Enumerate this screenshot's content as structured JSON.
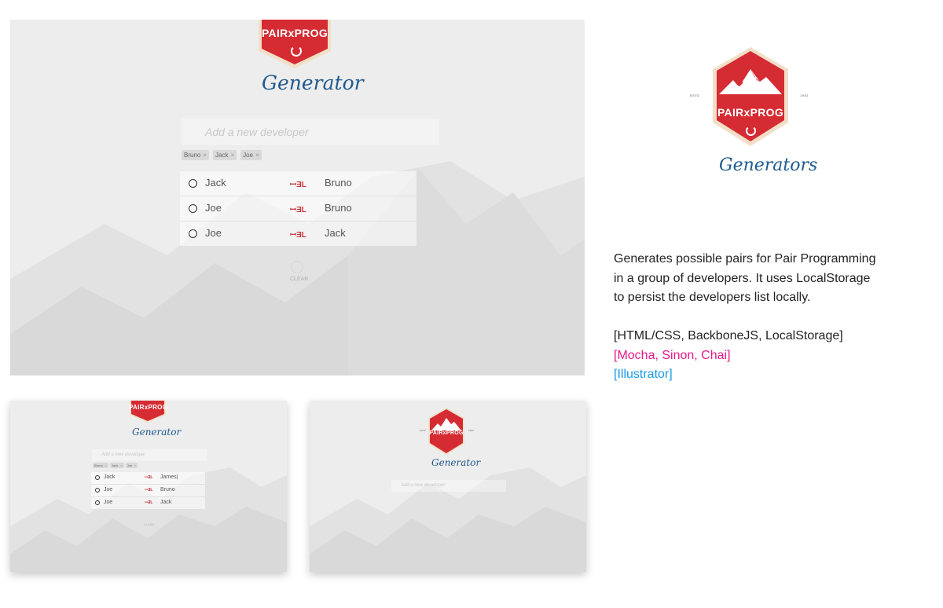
{
  "app": {
    "brand": "PAIRxPROG",
    "subtitle": "Generator",
    "subtitle_plural": "Generators",
    "input_placeholder": "Add a new developer",
    "clear_label": "CLEAR"
  },
  "hero_logo": {
    "estd": "ESTD",
    "year": "1992"
  },
  "main_screen": {
    "tags": [
      "Bruno",
      "Jack",
      "Joe"
    ],
    "pairs": [
      {
        "left": "Jack",
        "right": "Bruno"
      },
      {
        "left": "Joe",
        "right": "Bruno"
      },
      {
        "left": "Joe",
        "right": "Jack"
      }
    ]
  },
  "thumb_left": {
    "tags": [
      "Bruno",
      "Jack",
      "Joe"
    ],
    "pairs": [
      {
        "left": "Jack",
        "right": "James|"
      },
      {
        "left": "Joe",
        "right": "Bruno"
      },
      {
        "left": "Joe",
        "right": "Jack"
      }
    ]
  },
  "thumb_right": {
    "estd": "ESTD",
    "year": "1992"
  },
  "description": {
    "line1": "Generates possible pairs for Pair Programming",
    "line2": "in a group of developers. It uses LocalStorage",
    "line3": "to persist the developers list locally.",
    "tech": "[HTML/CSS, BackboneJS, LocalStorage]",
    "testing": "[Mocha, Sinon, Chai]",
    "design": "[Illustrator]"
  },
  "icons": {
    "face": "developer-face-icon",
    "pair_link": "pair-link-icon",
    "refresh": "refresh-icon",
    "mountain": "mountain-icon"
  },
  "colors": {
    "brand_red": "#d52b33",
    "script_blue": "#1f5a8f",
    "pink": "#e8198b",
    "blue": "#1a9be8"
  }
}
